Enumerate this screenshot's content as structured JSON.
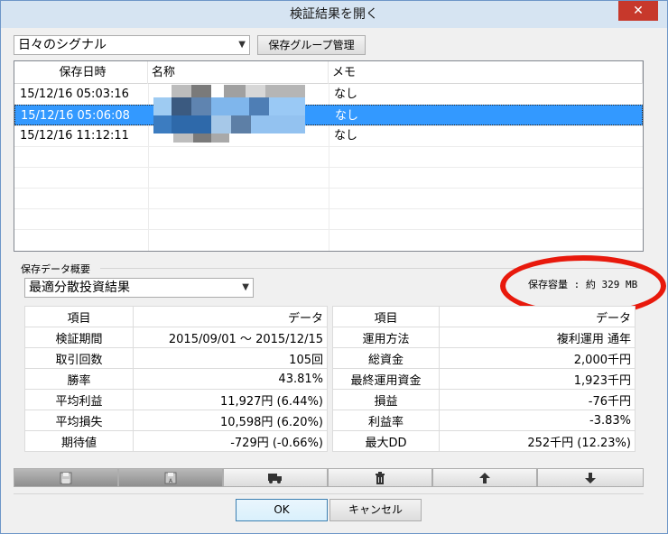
{
  "window": {
    "title": "検証結果を開く",
    "close_label": "✕"
  },
  "group_select": {
    "value": "日々のシグナル"
  },
  "group_manage_button": "保存グループ管理",
  "list": {
    "columns": [
      "保存日時",
      "名称",
      "メモ"
    ],
    "rows": [
      {
        "datetime": "15/12/16  05:03:16",
        "memo": "なし"
      },
      {
        "datetime": "15/12/16  05:06:08",
        "memo": "なし"
      },
      {
        "datetime": "15/12/16  11:12:11",
        "memo": "なし"
      }
    ]
  },
  "summary": {
    "section_label": "保存データ概要",
    "type_select": "最適分散投資結果",
    "capacity": "保存容量 : 約 329 MB",
    "left_table": {
      "headers": [
        "項目",
        "データ"
      ],
      "rows": [
        [
          "検証期間",
          "2015/09/01 〜 2015/12/15"
        ],
        [
          "取引回数",
          "105回"
        ],
        [
          "勝率",
          "43.81%"
        ],
        [
          "平均利益",
          "11,927円 (6.44%)"
        ],
        [
          "平均損失",
          "10,598円 (6.20%)"
        ],
        [
          "期待値",
          "-729円 (-0.66%)"
        ]
      ]
    },
    "right_table": {
      "headers": [
        "項目",
        "データ"
      ],
      "rows": [
        [
          "運用方法",
          "複利運用  通年"
        ],
        [
          "総資金",
          "2,000千円"
        ],
        [
          "最終運用資金",
          "1,923千円"
        ],
        [
          "損益",
          "-76千円"
        ],
        [
          "利益率",
          "-3.83%"
        ],
        [
          "最大DD",
          "252千円 (12.23%)"
        ]
      ]
    }
  },
  "toolbar": {
    "icons": [
      "save-icon",
      "save-as-icon",
      "truck-icon",
      "trash-icon",
      "arrow-up-icon",
      "arrow-down-icon"
    ]
  },
  "footer": {
    "ok": "OK",
    "cancel": "キャンセル"
  },
  "colors": {
    "selection": "#3399ff",
    "highlight_ring": "#e8190c"
  }
}
